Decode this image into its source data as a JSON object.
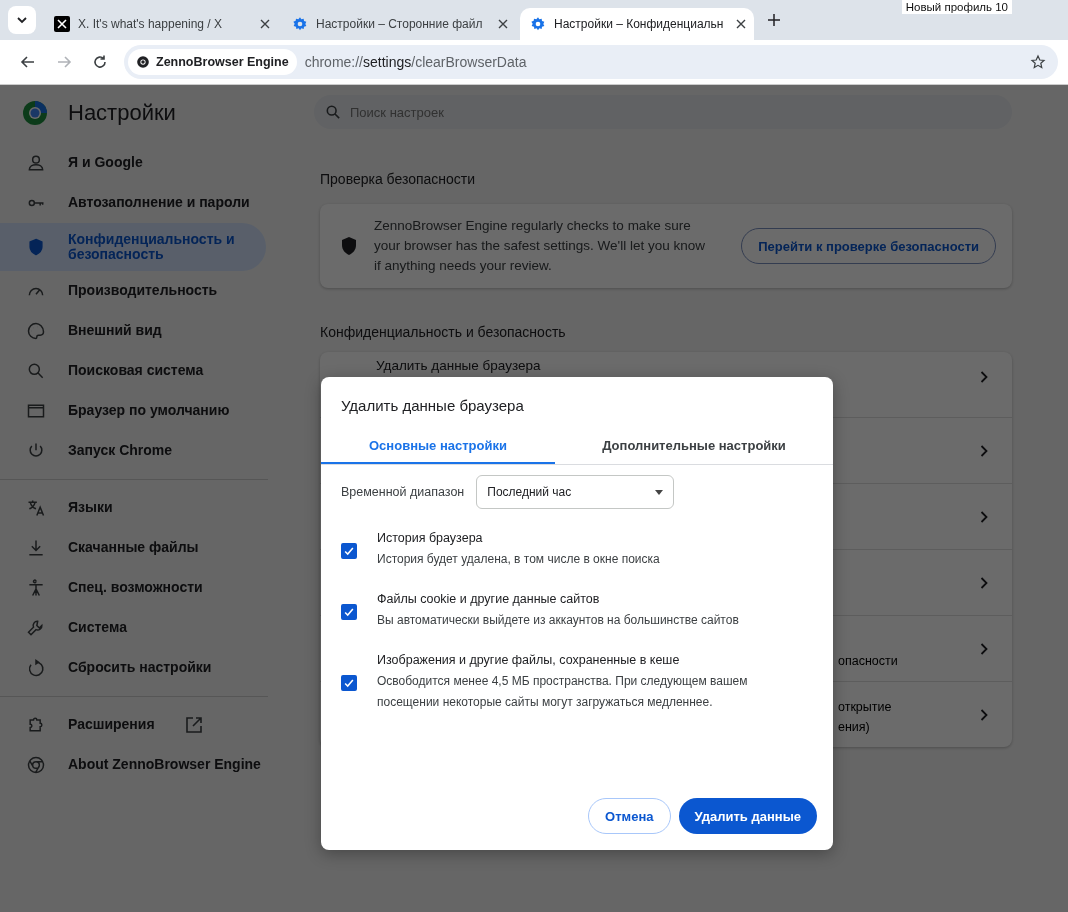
{
  "browser_tabs": [
    {
      "title": "X. It's what's happening / X",
      "kind": "x",
      "selected": false
    },
    {
      "title": "Настройки – Сторонние файл",
      "kind": "settings",
      "selected": false
    },
    {
      "title": "Настройки – Конфиденциальн",
      "kind": "settings",
      "selected": true
    }
  ],
  "profile_badge": "Новый профиль 10",
  "toolbar": {
    "forward_disabled": true,
    "site_chip": "ZennoBrowser Engine",
    "url_host": "chrome://",
    "url_bold": "settings",
    "url_path": "/clearBrowserData"
  },
  "sidebar": {
    "title": "Настройки",
    "groups": [
      [
        {
          "label": "Я и Google",
          "selected": false
        },
        {
          "label": "Автозаполнение и пароли",
          "selected": false
        },
        {
          "label": "Конфиденциальность и безопасность",
          "selected": true
        },
        {
          "label": "Производительность",
          "selected": false
        },
        {
          "label": "Внешний вид",
          "selected": false
        },
        {
          "label": "Поисковая система",
          "selected": false
        },
        {
          "label": "Браузер по умолчанию",
          "selected": false
        },
        {
          "label": "Запуск Chrome",
          "selected": false
        }
      ],
      [
        {
          "label": "Языки",
          "selected": false
        },
        {
          "label": "Скачанные файлы",
          "selected": false
        },
        {
          "label": "Спец. возможности",
          "selected": false
        },
        {
          "label": "Система",
          "selected": false
        },
        {
          "label": "Сбросить настройки",
          "selected": false
        }
      ],
      [
        {
          "label": "Расширения",
          "selected": false,
          "external": true
        },
        {
          "label": "About ZennoBrowser Engine",
          "selected": false
        }
      ]
    ]
  },
  "search": {
    "placeholder": "Поиск настроек"
  },
  "safety_check": {
    "heading": "Проверка безопасности",
    "text": "ZennoBrowser Engine regularly checks to make sure your browser has the safest settings. We'll let you know if anything needs your review.",
    "button": "Перейти к проверке безопасности"
  },
  "privacy": {
    "heading": "Конфиденциальность и безопасность",
    "rows": [
      {
        "title": "Удалить данные браузера"
      },
      {
        "lines": []
      },
      {
        "lines": []
      },
      {
        "lines": []
      },
      {
        "lines": [
          "опасности"
        ]
      },
      {
        "lines": [
          "открытие",
          "ения)"
        ]
      }
    ]
  },
  "dialog": {
    "title": "Удалить данные браузера",
    "tabs": [
      {
        "label": "Основные настройки",
        "selected": true
      },
      {
        "label": "Дополнительные настройки",
        "selected": false
      }
    ],
    "time_range": {
      "label": "Временной диапазон",
      "value": "Последний час"
    },
    "options": [
      {
        "title": "История браузера",
        "description": "История будет удалена, в том числе в окне поиска",
        "checked": true
      },
      {
        "title": "Файлы cookie и другие данные сайтов",
        "description": "Вы автоматически выйдете из аккаунтов на большинстве сайтов",
        "checked": true
      },
      {
        "title": "Изображения и другие файлы, сохраненные в кеше",
        "description": "Освободится менее 4,5 МБ пространства. При следующем вашем посещении некоторые сайты могут загружаться медленнее.",
        "checked": true
      }
    ],
    "cancel": "Отмена",
    "confirm": "Удалить данные"
  }
}
